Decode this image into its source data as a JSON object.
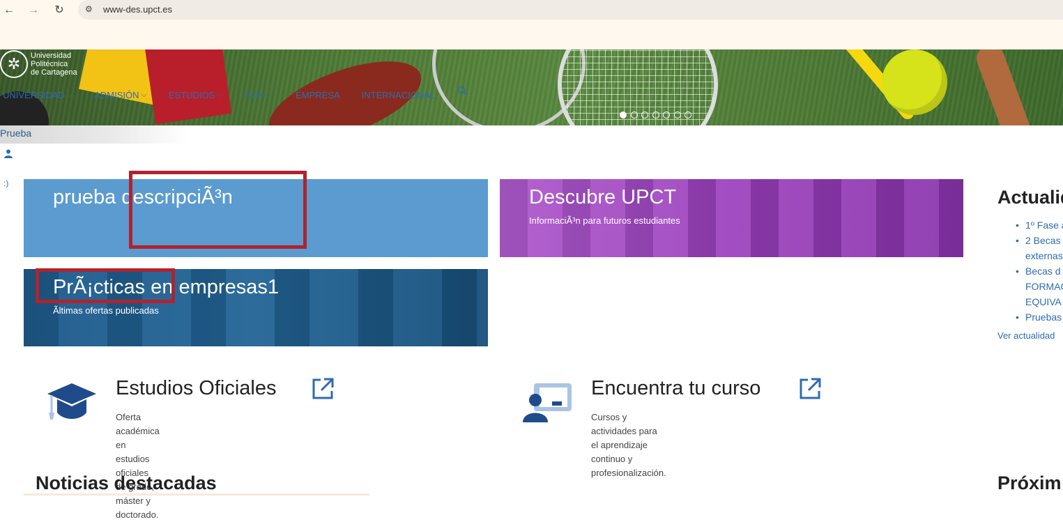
{
  "browser": {
    "back_icon": "←",
    "forward_icon": "→",
    "reload_icon": "↻",
    "url": "www-des.upct.es"
  },
  "logo": {
    "line1": "Universidad",
    "line2": "Politécnica",
    "line3": "de Cartagena"
  },
  "nav": {
    "items": [
      {
        "label": "UNIVERSIDAD",
        "has_dropdown": true
      },
      {
        "label": "ADMISIÓN",
        "has_dropdown": true
      },
      {
        "label": "ESTUDIOS",
        "has_dropdown": true
      },
      {
        "label": "I+D+i",
        "has_dropdown": true
      },
      {
        "label": "EMPRESA",
        "has_dropdown": false
      },
      {
        "label": "INTERNACIONAL",
        "has_dropdown": false
      }
    ],
    "chevron": "⌵"
  },
  "carousel": {
    "slides": 7,
    "active": 1
  },
  "breadcrumb": {
    "label": "Prueba"
  },
  "smiley": ":)",
  "cards": [
    {
      "title": "prueba descripciÃ³n",
      "subtitle": "",
      "color": "#5b9bd0"
    },
    {
      "title": "Descubre UPCT",
      "subtitle": "InformaciÃ³n para futuros estudiantes",
      "color": "#9a3fb7"
    },
    {
      "title": "PrÃ¡cticas en empresas1",
      "subtitle": "Ãltimas ofertas publicadas",
      "color": "#1e5a8a"
    }
  ],
  "sidebar": {
    "title": "Actualidad",
    "items": [
      "1º Fase a",
      "2 Becas",
      "externas",
      "Becas d",
      "FORMAC",
      "EQUIVA",
      "Pruebas"
    ],
    "more_link": "Ver actualidad"
  },
  "features": [
    {
      "title": "Estudios Oficiales",
      "desc_line1": "Oferta académica en estudios oficiales de grado,",
      "desc_line2": "máster y doctorado."
    },
    {
      "title": "Encuentra tu curso",
      "desc_line1": "Cursos y actividades para el aprendizaje continuo y",
      "desc_line2": "profesionalización."
    }
  ],
  "sections": {
    "news": "Noticias destacadas",
    "upcoming": "Próxim"
  },
  "colors": {
    "link": "#2d6cb0",
    "icon_dark": "#1f4b8a",
    "icon_light": "#a9c4e4",
    "annotation_red": "#b0232d"
  }
}
